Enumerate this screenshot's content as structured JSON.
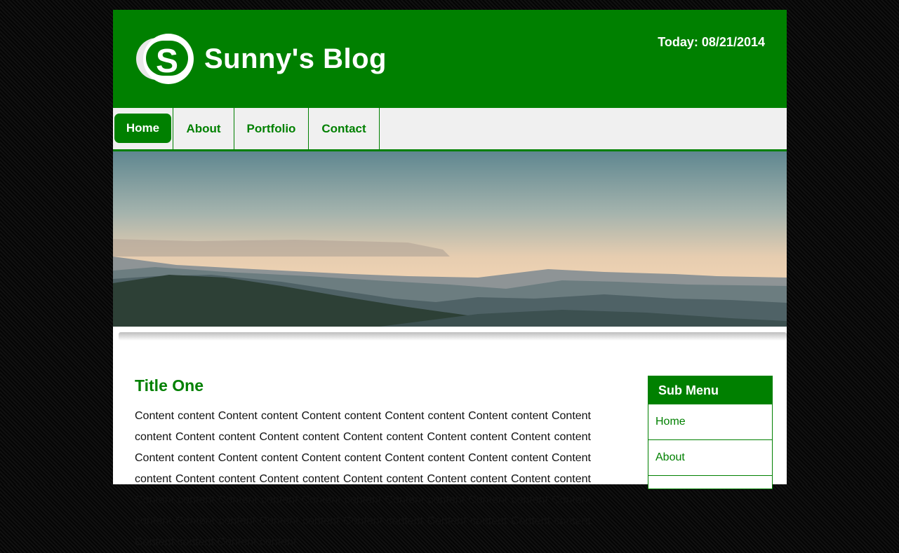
{
  "header": {
    "logo_letter": "S",
    "site_title": "Sunny's Blog",
    "today": "Today: 08/21/2014"
  },
  "nav": {
    "items": [
      {
        "label": "Home"
      },
      {
        "label": "About"
      },
      {
        "label": "Portfolio"
      },
      {
        "label": "Contact"
      }
    ]
  },
  "main": {
    "title": "Title One",
    "text": "Content content Content content Content content Content content Content content Content content Content content Content content Content content Content content Content content Content content Content content Content content Content content Content content Content content Content content Content content Content content Content content Content content Content content Content content Content content Content content Content content Content content Content content Content content Content content Content content Content content Content content Content content"
  },
  "submenu": {
    "title": "Sub Menu",
    "items": [
      {
        "label": "Home"
      },
      {
        "label": "About"
      }
    ]
  },
  "colors": {
    "brand_green": "#008000",
    "nav_bg": "#f0f0f0"
  }
}
